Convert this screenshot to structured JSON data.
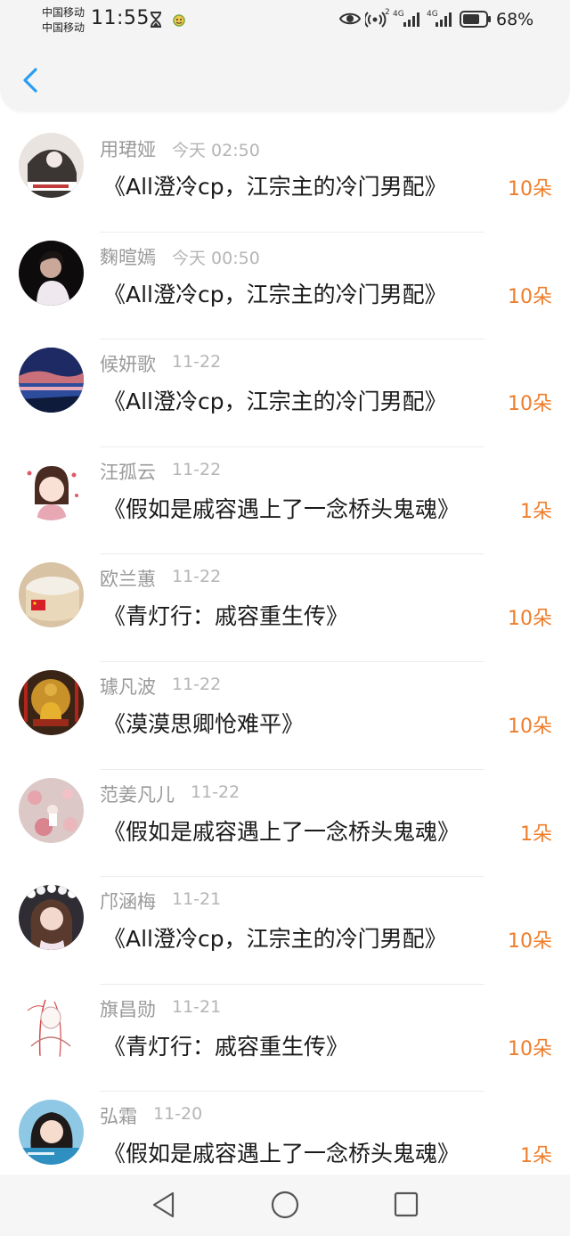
{
  "status_bar": {
    "carrier_1": "中国移动",
    "carrier_2": "中国移动",
    "time": "11:55",
    "battery_percent": "68%",
    "network_label_1": "4G",
    "network_label_2": "4G",
    "sim_number": "2",
    "icons": [
      "hourglass-icon",
      "emoji-icon",
      "eye-icon",
      "hotspot-icon",
      "signal-icon",
      "battery-icon"
    ]
  },
  "header": {
    "back_icon": "chevron-left-icon",
    "accent_color": "#2a9df4"
  },
  "list": {
    "count_color": "#ef7d2a",
    "items": [
      {
        "name": "用珺娅",
        "time": "今天 02:50",
        "title": "《All澄冷cp，江宗主的冷门男配》",
        "count": "10朵"
      },
      {
        "name": "麴暄嫣",
        "time": "今天 00:50",
        "title": "《All澄冷cp，江宗主的冷门男配》",
        "count": "10朵"
      },
      {
        "name": "候妍歌",
        "time": "11-22",
        "title": "《All澄冷cp，江宗主的冷门男配》",
        "count": "10朵"
      },
      {
        "name": "汪孤云",
        "time": "11-22",
        "title": "《假如是戚容遇上了一念桥头鬼魂》",
        "count": "1朵"
      },
      {
        "name": "欧兰蕙",
        "time": "11-22",
        "title": "《青灯行：戚容重生传》",
        "count": "10朵"
      },
      {
        "name": "璩凡波",
        "time": "11-22",
        "title": "《漠漠思卿怆难平》",
        "count": "10朵"
      },
      {
        "name": "范姜凡儿",
        "time": "11-22",
        "title": "《假如是戚容遇上了一念桥头鬼魂》",
        "count": "1朵"
      },
      {
        "name": "邝涵梅",
        "time": "11-21",
        "title": "《All澄冷cp，江宗主的冷门男配》",
        "count": "10朵"
      },
      {
        "name": "旗昌勋",
        "time": "11-21",
        "title": "《青灯行：戚容重生传》",
        "count": "10朵"
      },
      {
        "name": "弘霜",
        "time": "11-20",
        "title": "《假如是戚容遇上了一念桥头鬼魂》",
        "count": "1朵"
      }
    ]
  },
  "bottom_nav": {
    "icons": [
      "back-triangle-icon",
      "home-circle-icon",
      "recents-square-icon"
    ]
  }
}
